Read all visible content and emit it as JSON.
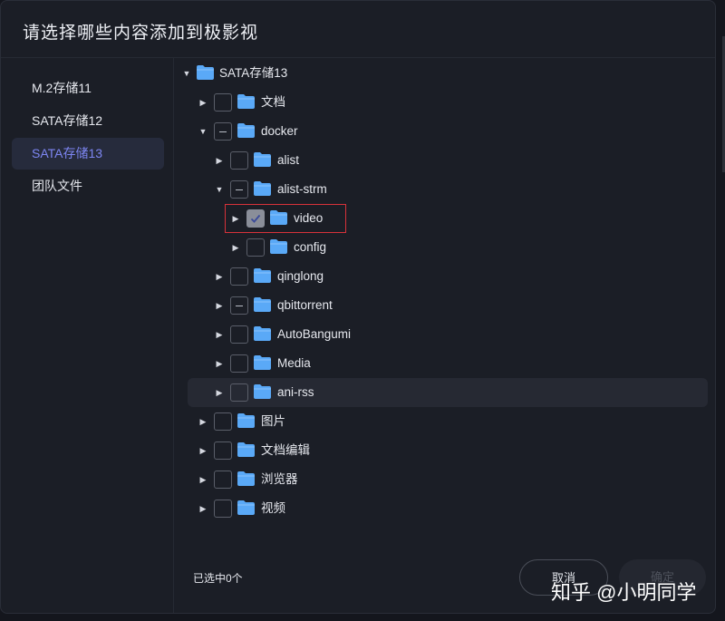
{
  "dialog": {
    "title": "请选择哪些内容添加到极影视",
    "status_text": "已选中0个",
    "cancel_label": "取消",
    "ok_label": "确定"
  },
  "sidebar": {
    "items": [
      {
        "label": "M.2存储11",
        "active": false
      },
      {
        "label": "SATA存储12",
        "active": false
      },
      {
        "label": "SATA存储13",
        "active": true
      },
      {
        "label": "团队文件",
        "active": false
      }
    ]
  },
  "tree": {
    "rows": [
      {
        "label": "SATA存储13",
        "depth": 0,
        "expanded": true,
        "checkbox": "none"
      },
      {
        "label": "文档",
        "depth": 1,
        "expanded": false,
        "checkbox": "unchecked"
      },
      {
        "label": "docker",
        "depth": 1,
        "expanded": true,
        "checkbox": "partial"
      },
      {
        "label": "alist",
        "depth": 2,
        "expanded": false,
        "checkbox": "unchecked"
      },
      {
        "label": "alist-strm",
        "depth": 2,
        "expanded": true,
        "checkbox": "partial"
      },
      {
        "label": "video",
        "depth": 3,
        "expanded": false,
        "checkbox": "checked"
      },
      {
        "label": "config",
        "depth": 3,
        "expanded": false,
        "checkbox": "unchecked"
      },
      {
        "label": "qinglong",
        "depth": 2,
        "expanded": false,
        "checkbox": "unchecked"
      },
      {
        "label": "qbittorrent",
        "depth": 2,
        "expanded": false,
        "checkbox": "partial"
      },
      {
        "label": "AutoBangumi",
        "depth": 2,
        "expanded": false,
        "checkbox": "unchecked"
      },
      {
        "label": "Media",
        "depth": 2,
        "expanded": false,
        "checkbox": "unchecked"
      },
      {
        "label": "ani-rss",
        "depth": 2,
        "expanded": false,
        "checkbox": "unchecked",
        "hovered": true
      },
      {
        "label": "图片",
        "depth": 1,
        "expanded": false,
        "checkbox": "unchecked"
      },
      {
        "label": "文档编辑",
        "depth": 1,
        "expanded": false,
        "checkbox": "unchecked"
      },
      {
        "label": "浏览器",
        "depth": 1,
        "expanded": false,
        "checkbox": "unchecked"
      },
      {
        "label": "视频",
        "depth": 1,
        "expanded": false,
        "checkbox": "unchecked"
      }
    ]
  },
  "watermark": "知乎 @小明同学",
  "colors": {
    "accent": "#7d86f2",
    "folder": "#5aa9f7",
    "highlight_border": "#d8323a"
  }
}
